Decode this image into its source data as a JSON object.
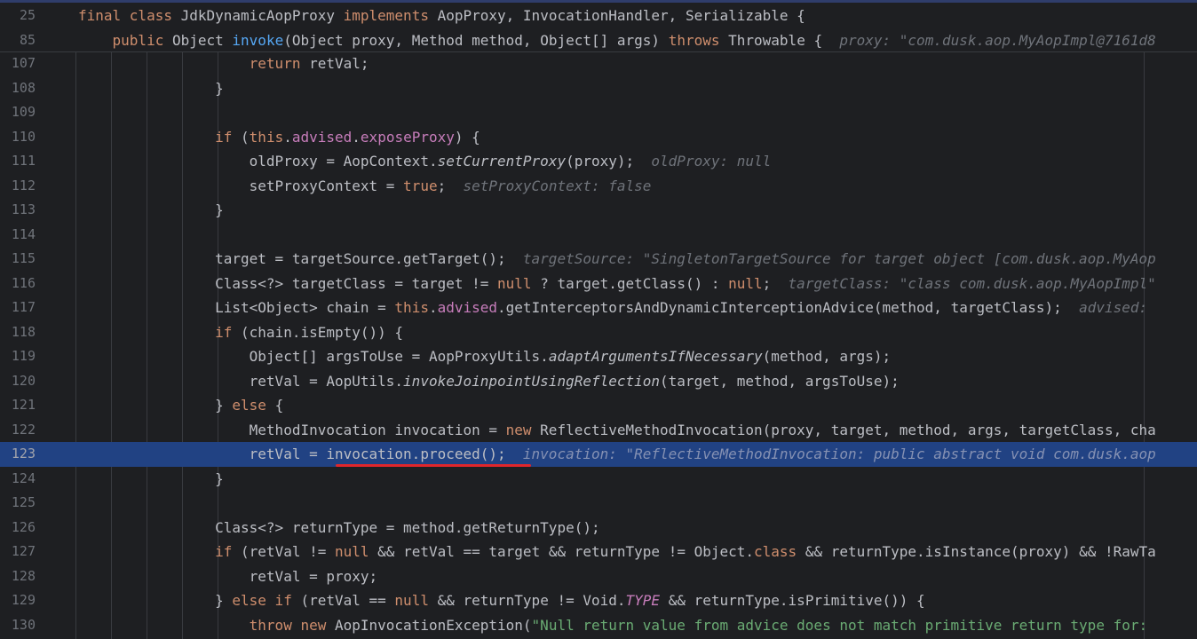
{
  "sticky": [
    {
      "num": "25",
      "code": "final class JdkDynamicAopProxy implements AopProxy, InvocationHandler, Serializable {"
    },
    {
      "num": "85",
      "code": "    public Object invoke(Object proxy, Method method, Object[] args) throws Throwable {",
      "hint": "proxy: \"com.dusk.aop.MyAopImpl@7161d8"
    }
  ],
  "lines": [
    {
      "num": "107",
      "code": "                    return retVal;"
    },
    {
      "num": "108",
      "code": "                }"
    },
    {
      "num": "109",
      "code": ""
    },
    {
      "num": "110",
      "code": "                if (this.advised.exposeProxy) {"
    },
    {
      "num": "111",
      "code": "                    oldProxy = AopContext.setCurrentProxy(proxy);",
      "hint": "oldProxy: null"
    },
    {
      "num": "112",
      "code": "                    setProxyContext = true;",
      "hint": "setProxyContext: false"
    },
    {
      "num": "113",
      "code": "                }"
    },
    {
      "num": "114",
      "code": ""
    },
    {
      "num": "115",
      "code": "                target = targetSource.getTarget();",
      "hint": "targetSource: \"SingletonTargetSource for target object [com.dusk.aop.MyAop"
    },
    {
      "num": "116",
      "code": "                Class<?> targetClass = target != null ? target.getClass() : null;",
      "hint": "targetClass: \"class com.dusk.aop.MyAopImpl\""
    },
    {
      "num": "117",
      "code": "                List<Object> chain = this.advised.getInterceptorsAndDynamicInterceptionAdvice(method, targetClass);",
      "hint": "advised: "
    },
    {
      "num": "118",
      "code": "                if (chain.isEmpty()) {"
    },
    {
      "num": "119",
      "code": "                    Object[] argsToUse = AopProxyUtils.adaptArgumentsIfNecessary(method, args);"
    },
    {
      "num": "120",
      "code": "                    retVal = AopUtils.invokeJoinpointUsingReflection(target, method, argsToUse);"
    },
    {
      "num": "121",
      "code": "                } else {"
    },
    {
      "num": "122",
      "code": "                    MethodInvocation invocation = new ReflectiveMethodInvocation(proxy, target, method, args, targetClass, cha"
    },
    {
      "num": "123",
      "code": "                    retVal = invocation.proceed();",
      "hint": "invocation: \"ReflectiveMethodInvocation: public abstract void com.dusk.aop"
    },
    {
      "num": "124",
      "code": "                }"
    },
    {
      "num": "125",
      "code": ""
    },
    {
      "num": "126",
      "code": "                Class<?> returnType = method.getReturnType();"
    },
    {
      "num": "127",
      "code": "                if (retVal != null && retVal == target && returnType != Object.class && returnType.isInstance(proxy) && !RawTa"
    },
    {
      "num": "128",
      "code": "                    retVal = proxy;"
    },
    {
      "num": "129",
      "code": "                } else if (retVal == null && returnType != Void.TYPE && returnType.isPrimitive()) {"
    },
    {
      "num": "130",
      "code": "                    throw new AopInvocationException(\"Null return value from advice does not match primitive return type for: "
    }
  ],
  "current_line": "123",
  "colors": {
    "background": "#1e1f22",
    "current_line": "#214283",
    "keyword": "#cf8e6d",
    "method_declaration": "#56a8f5",
    "field": "#c77dbb",
    "string": "#6aab73",
    "inline_hint": "#6f737a",
    "marker": "#e0262b"
  }
}
